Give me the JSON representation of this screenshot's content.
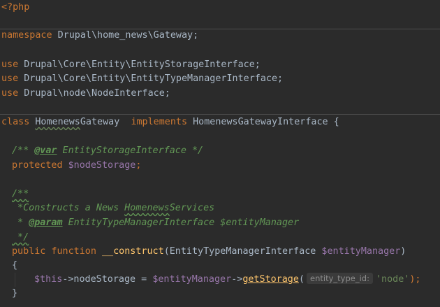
{
  "editor": {
    "lines": {
      "php_open": "<?php",
      "namespace_kw": "namespace",
      "namespace_value": " Drupal\\home_news\\Gateway;",
      "use_kw": "use",
      "use1_value": " Drupal\\Core\\Entity\\EntityStorageInterface;",
      "use2_value": " Drupal\\Core\\Entity\\EntityTypeManagerInterface;",
      "use3_value": " Drupal\\node\\NodeInterface;",
      "class_kw": "class",
      "class_name_a": "Homenews",
      "class_name_b": "Gateway",
      "implements_kw": "implements",
      "interface_name": " HomenewsGatewayInterface {",
      "doc1_open": "/** ",
      "doc1_tag": "@var",
      "doc1_rest": " EntityStorageInterface */",
      "protected_kw": "protected",
      "property": " $nodeStorage",
      "semicolon": ";",
      "doc2_open": "/**",
      "doc2_line1_a": " *Constructs a News ",
      "doc2_line1_b": "Homenews",
      "doc2_line1_c": "Services",
      "doc2_line2_a": " * ",
      "doc2_line2_tag": "@param",
      "doc2_line2_b": " EntityTypeManagerInterface $entityManager",
      "doc2_close": " */",
      "public_kw": "public",
      "function_kw": "function",
      "fn_name": "__construct",
      "fn_params_a": "(EntityTypeManagerInterface ",
      "fn_param_var": "$entityManager",
      "fn_params_b": ")",
      "open_brace": "{",
      "this_var": "$this",
      "assign_a": "->nodeStorage = ",
      "manager_var": "$entityManager",
      "arrow": "->",
      "method_call": "getStorage",
      "paren_open": "(",
      "param_hint": "entity_type_id:",
      "string_arg": "'node'",
      "call_close": ");",
      "close_brace": "}"
    }
  }
}
